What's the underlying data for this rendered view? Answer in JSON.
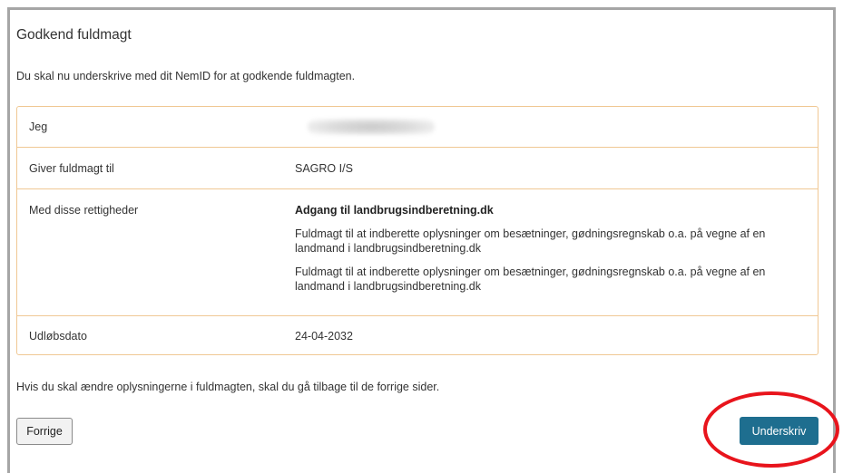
{
  "page": {
    "title": "Godkend fuldmagt",
    "intro": "Du skal nu underskrive med dit NemID for at godkende fuldmagten."
  },
  "table": {
    "rows": [
      {
        "label": "Jeg",
        "value": ""
      },
      {
        "label": "Giver fuldmagt til",
        "value": "SAGRO I/S"
      },
      {
        "label": "Med disse rettigheder",
        "value_title": "Adgang til landbrugsindberetning.dk",
        "value_lines": [
          "Fuldmagt til at indberette oplysninger om besætninger, gødningsregnskab o.a. på vegne af en landmand i landbrugsindberetning.dk",
          "Fuldmagt til at indberette oplysninger om besætninger, gødningsregnskab o.a. på vegne af en landmand i landbrugsindberetning.dk"
        ]
      },
      {
        "label": "Udløbsdato",
        "value": "24-04-2032"
      }
    ]
  },
  "footer": {
    "note": "Hvis du skal ændre oplysningerne i fuldmagten, skal du gå tilbage til de forrige sider.",
    "prev_label": "Forrige",
    "sign_label": "Underskriv"
  },
  "colors": {
    "accent": "#1e6e8f",
    "table_border": "#f0c894",
    "annotation": "#e8141c"
  }
}
